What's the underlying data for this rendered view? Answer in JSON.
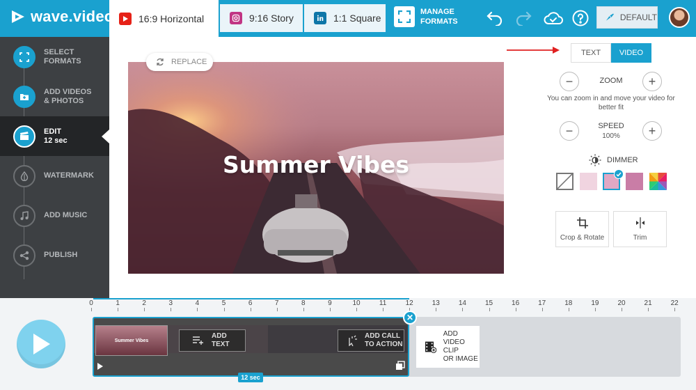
{
  "app": {
    "name": "wave.video"
  },
  "tabs": [
    {
      "label": "16:9 Horizontal",
      "icon": "youtube-icon",
      "color": "#e62117"
    },
    {
      "label": "9:16 Story",
      "icon": "instagram-icon",
      "color": "#c13584"
    },
    {
      "label": "1:1 Square",
      "icon": "linkedin-icon",
      "color": "#0e76a8"
    }
  ],
  "header": {
    "manage_line1": "MANAGE",
    "manage_line2": "FORMATS",
    "default_label": "DEFAULT"
  },
  "sidebar": {
    "steps": [
      {
        "line1": "SELECT",
        "line2": "FORMATS",
        "icon": "formats-icon",
        "state": "done"
      },
      {
        "line1": "ADD VIDEOS",
        "line2": "& PHOTOS",
        "icon": "folder-icon",
        "state": "done"
      },
      {
        "line1": "EDIT",
        "line2": "12 sec",
        "icon": "clapper-icon",
        "state": "active"
      },
      {
        "line1": "WATERMARK",
        "line2": "",
        "icon": "drop-icon",
        "state": "pending"
      },
      {
        "line1": "ADD MUSIC",
        "line2": "",
        "icon": "music-note-icon",
        "state": "pending"
      },
      {
        "line1": "PUBLISH",
        "line2": "",
        "icon": "share-icon",
        "state": "pending"
      }
    ]
  },
  "canvas": {
    "replace_label": "REPLACE",
    "video_title": "Summer Vibes"
  },
  "panel": {
    "text_tab": "TEXT",
    "video_tab": "VIDEO",
    "zoom_label": "ZOOM",
    "zoom_hint": "You can zoom in and move your video for better fit",
    "speed_label": "SPEED",
    "speed_value": "100%",
    "dimmer_label": "DIMMER",
    "swatches": [
      "none",
      "#f0d4e0",
      "#e0a8c4",
      "#c97da6",
      "rainbow"
    ],
    "selected_swatch": 2,
    "crop_label": "Crop & Rotate",
    "trim_label": "Trim"
  },
  "timeline": {
    "ticks": [
      "0",
      "1",
      "2",
      "3",
      "4",
      "5",
      "6",
      "7",
      "8",
      "9",
      "10",
      "11",
      "12",
      "13",
      "14",
      "15",
      "16",
      "17",
      "18",
      "19",
      "20",
      "21",
      "22"
    ],
    "add_text_line1": "ADD",
    "add_text_line2": "TEXT",
    "add_cta_line1": "ADD CALL",
    "add_cta_line2": "TO ACTION",
    "thumb_caption": "Summer Vibes",
    "duration_badge": "12 sec",
    "add_clip_line1": "ADD",
    "add_clip_line2": "VIDEO CLIP",
    "add_clip_line3": "OR IMAGE"
  },
  "colors": {
    "brand": "#1aa1cf",
    "sidebar": "#3d4043"
  }
}
